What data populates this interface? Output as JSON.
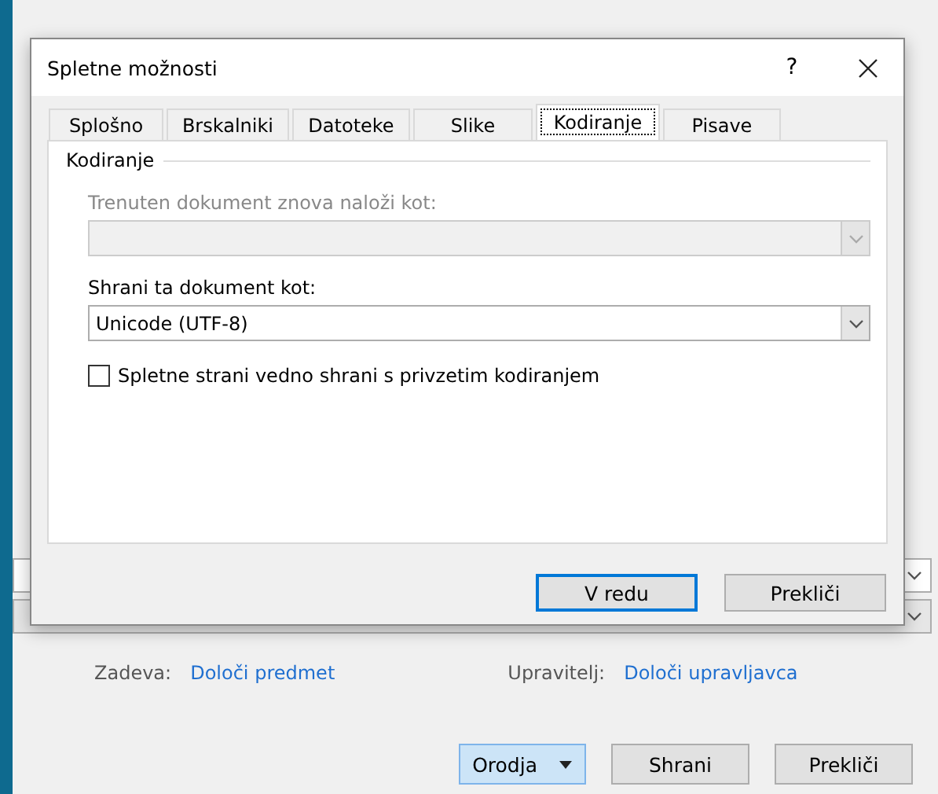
{
  "background_window": {
    "dropdowns": [
      {
        "disabled": false
      },
      {
        "disabled": true
      }
    ],
    "fields": [
      {
        "label": "Zadeva:",
        "link": "Določi predmet"
      },
      {
        "label": "Upravitelj:",
        "link": "Določi upravljavca"
      }
    ],
    "buttons": [
      {
        "label": "Orodja",
        "kind": "split",
        "selected": true
      },
      {
        "label": "Shrani",
        "kind": "plain",
        "selected": false
      },
      {
        "label": "Prekliči",
        "kind": "plain",
        "selected": false
      }
    ]
  },
  "dialog": {
    "title": "Spletne možnosti",
    "help": "?",
    "tabs": [
      {
        "label": "Splošno",
        "selected": false
      },
      {
        "label": "Brskalniki",
        "selected": false
      },
      {
        "label": "Datoteke",
        "selected": false
      },
      {
        "label": "Slike",
        "selected": false
      },
      {
        "label": "Kodiranje",
        "selected": true
      },
      {
        "label": "Pisave",
        "selected": false
      }
    ],
    "group": {
      "title": "Kodiranje",
      "controls": [
        {
          "kind": "dropdown",
          "label": "Trenuten dokument znova naloži kot:",
          "disabled": true
        },
        {
          "kind": "dropdown",
          "label": "Shrani ta dokument kot:",
          "value": "Unicode (UTF-8)",
          "disabled": false
        },
        {
          "kind": "checkbox",
          "label": "Spletne strani vedno shrani s privzetim kodiranjem",
          "checked": false
        }
      ]
    },
    "buttons": [
      {
        "label": "V redu",
        "default": true
      },
      {
        "label": "Prekliči",
        "default": false
      }
    ]
  }
}
